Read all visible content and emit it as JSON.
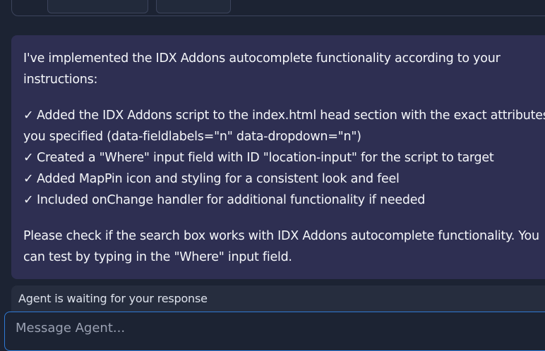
{
  "message": {
    "intro": "I've implemented the IDX Addons autocomplete functionality according to your instructions:",
    "checkmark": "✓",
    "items": [
      "Added the IDX Addons script to the index.html head section with the exact attributes you specified (data-fieldlabels=\"n\" data-dropdown=\"n\")",
      "Created a \"Where\" input field with ID \"location-input\" for the script to target",
      "Added MapPin icon and styling for a consistent look and feel",
      "Included onChange handler for additional functionality if needed"
    ],
    "closing": "Please check if the search box works with IDX Addons autocomplete functionality. You can test by typing in the \"Where\" input field."
  },
  "status": {
    "text": "Agent is waiting for your response"
  },
  "composer": {
    "placeholder": "Message Agent..."
  }
}
